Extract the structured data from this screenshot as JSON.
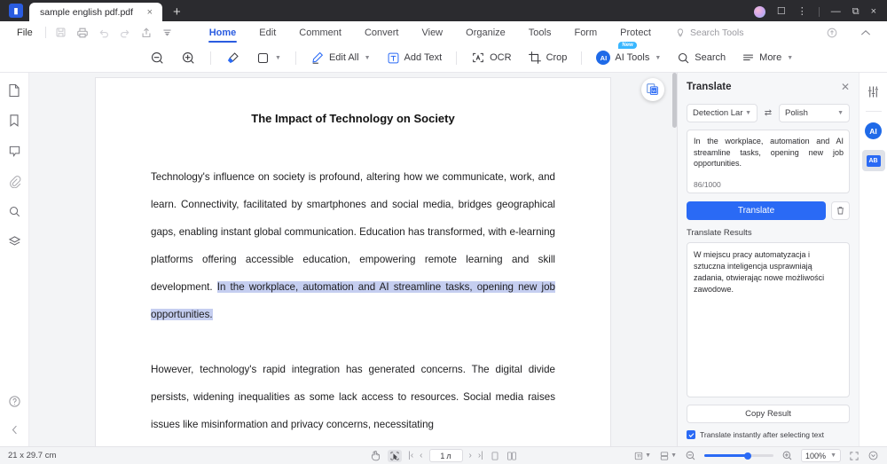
{
  "titlebar": {
    "tab_label": "sample english pdf.pdf",
    "close_label": "×",
    "new_tab_label": "+",
    "minimize_label": "—",
    "maximize_label": "❐",
    "window_close_label": "×",
    "more_label": "⋮"
  },
  "menubar": {
    "file_label": "File",
    "tabs": [
      {
        "label": "Home",
        "active": true
      },
      {
        "label": "Edit",
        "active": false
      },
      {
        "label": "Comment",
        "active": false
      },
      {
        "label": "Convert",
        "active": false
      },
      {
        "label": "View",
        "active": false
      },
      {
        "label": "Organize",
        "active": false
      },
      {
        "label": "Tools",
        "active": false
      },
      {
        "label": "Form",
        "active": false
      },
      {
        "label": "Protect",
        "active": false
      }
    ],
    "search_tools_label": "Search Tools"
  },
  "toolbar": {
    "zoom_out_name": "zoom-out",
    "zoom_in_name": "zoom-in",
    "highlight_name": "highlight",
    "shape_name": "shape",
    "edit_all_label": "Edit All",
    "add_text_label": "Add Text",
    "ocr_label": "OCR",
    "crop_label": "Crop",
    "ai_tools_label": "AI Tools",
    "ai_tools_badge": "New",
    "search_label": "Search",
    "more_label": "More"
  },
  "left_rail": {
    "items": [
      {
        "name": "page-thumbnails-icon"
      },
      {
        "name": "bookmarks-icon"
      },
      {
        "name": "comments-icon"
      },
      {
        "name": "attachments-icon"
      },
      {
        "name": "search-icon"
      },
      {
        "name": "layers-icon"
      }
    ],
    "help_label": "?",
    "collapse_label": "‹"
  },
  "document": {
    "title": "The Impact of Technology on Society",
    "paragraph1_before": "Technology's influence on society is profound, altering how we communicate, work, and learn. Connectivity, facilitated by smartphones and social media, bridges geographical gaps, enabling instant global communication. Education has transformed, with e-learning platforms offering accessible education, empowering remote learning and skill development. ",
    "paragraph1_highlight": "In the workplace, automation and AI streamline tasks, opening new job opportunities.",
    "paragraph2": "However, technology's rapid integration has generated concerns. The digital divide persists, widening inequalities as some lack access to resources. Social media raises issues like misinformation and privacy concerns, necessitating",
    "float_button_name": "convert-to-word-button",
    "highlight_color": "#c5cef0"
  },
  "panel": {
    "title": "Translate",
    "close_label": "✕",
    "source_language": "Detection Lar",
    "target_language": "Polish",
    "swap_label": "⇄",
    "source_text": "In  the  workplace, automation and AI streamline tasks, opening new job opportunities.",
    "char_count": "86/1000",
    "translate_button": "Translate",
    "clear_button_name": "clear-trash-icon",
    "results_label": "Translate Results",
    "result_text": "W miejscu pracy automatyzacja i sztuczna inteligencja usprawniają zadania, otwierając nowe możliwości zawodowe.",
    "copy_button": "Copy Result",
    "auto_translate_label": "Translate instantly after selecting text",
    "auto_translate_checked": true,
    "accent_color": "#2a6af5"
  },
  "right_rail": {
    "settings_name": "settings-sliders-icon",
    "ai_label": "AI",
    "translate_label": "AB"
  },
  "statusbar": {
    "page_dimensions": "21 x 29.7 cm",
    "hand_tool_name": "hand-tool",
    "select_tool_name": "select-tool",
    "first_page_label": "|‹",
    "prev_page_label": "‹",
    "current_page": "1",
    "page_suffix": "л",
    "next_page_label": "›",
    "last_page_label": "›|",
    "single_page_name": "single-page-view",
    "facing_page_name": "facing-page-view",
    "layout_label": "1:1",
    "zoom_level": "100%",
    "fit_label": "⛶"
  }
}
